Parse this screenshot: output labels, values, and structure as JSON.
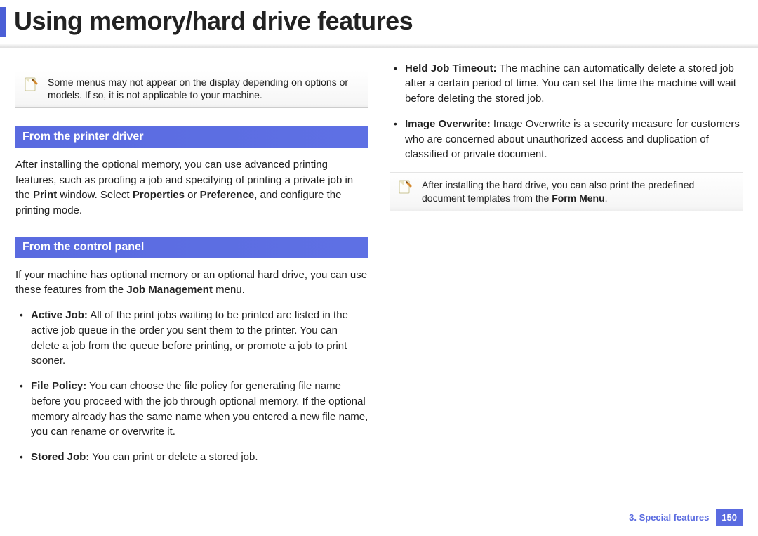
{
  "title": "Using memory/hard drive features",
  "note_top": "Some menus may not appear on the display depending on options or models. If so, it is not applicable to your machine.",
  "section1_header": "From the printer driver",
  "section1_p_a": "After installing the optional memory, you can use advanced printing features, such as proofing a job and specifying of printing a private job in the ",
  "section1_p_b": "Print",
  "section1_p_c": " window. Select ",
  "section1_p_d": "Properties",
  "section1_p_e": "  or  ",
  "section1_p_f": "Preference",
  "section1_p_g": ", and configure the printing mode.",
  "section2_header": "From the control panel",
  "section2_p_a": "If your machine has optional memory or an optional hard drive, you can use these features from the ",
  "section2_p_b": "Job Management",
  "section2_p_c": "  menu.",
  "bullets_left": {
    "b1_label": "Active Job:",
    "b1_text": "  All of the print jobs waiting to be printed are listed in the active job queue in the order you sent them to the printer. You can delete a job from the queue before printing, or promote a job to print sooner.",
    "b2_label": "File Policy:",
    "b2_text": "  You can choose the file policy for generating file name before you proceed with the job through optional memory. If the optional memory already has the same name when you entered a new file name, you can rename or overwrite it.",
    "b3_label": "Stored Job:",
    "b3_text": " You can print or delete a stored job."
  },
  "bullets_right": {
    "b4_label": "Held Job Timeout:",
    "b4_text": " The machine can automatically delete a stored job after a certain period of time. You can set the time the machine will wait before deleting the stored job.",
    "b5_label": "Image Overwrite:",
    "b5_text": " Image Overwrite is a security measure for customers who are concerned about unauthorized access and duplication of classified or private document."
  },
  "note_right_a": "After installing the hard drive, you can also print the predefined document templates from the ",
  "note_right_b": "Form Menu",
  "note_right_c": ".",
  "footer_chapter": "3.  Special features",
  "footer_page": "150"
}
